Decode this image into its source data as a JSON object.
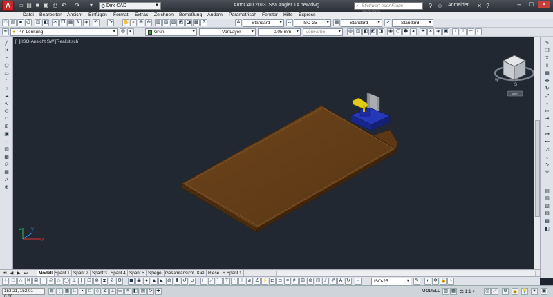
{
  "app": {
    "title": "AutoCAD 2013",
    "document": "Sea Angler 1A new.dwg",
    "workspace": "Dirk CAD",
    "search_placeholder": "Stichwort oder Frage eingeben",
    "signin": "Anmelden",
    "logo_letter": "A"
  },
  "menu": [
    "Datei",
    "Bearbeiten",
    "Ansicht",
    "Einfügen",
    "Format",
    "Extras",
    "Zeichnen",
    "Bemaßung",
    "Ändern",
    "Parametrisch",
    "Fenster",
    "Hilfe",
    "Express"
  ],
  "toolbar1": {
    "text_style": "Standard",
    "dim_style": "ISO-25",
    "table_style": "Standard",
    "mleader_style": "Standard"
  },
  "toolbar2": {
    "layer": "4n-Lenkung",
    "color": "Grün",
    "color_hex": "#2eab3a",
    "linetype": "VonLayer",
    "lineweight": "0.05 mm",
    "plotstyle": "VonFarbe"
  },
  "viewport": {
    "label": "[−][ISO-Ansicht SW][Realistisch]",
    "cube_label": "WKS",
    "compass_w": "W",
    "compass_s": "S"
  },
  "layout_tabs": [
    "Modell",
    "Spant 1",
    "Spant 2",
    "Spant 3",
    "Spant 4",
    "Spant 5",
    "Spiegel",
    "Gesamtansicht",
    "Kiel",
    "Riese",
    "B Spant 1"
  ],
  "active_tab": "Modell",
  "bottom_toolbar": {
    "dim_style": "ISO-25"
  },
  "status": {
    "coords": "153.21, 152.01 , 0.00",
    "space": "MODELL",
    "scale": "1:1"
  },
  "colors": {
    "board": "#5a3615",
    "board_top": "#6b4119",
    "clamp_blue": "#1c2fa5",
    "clamp_yellow": "#e3cc16",
    "viewport_bg": "#212831"
  }
}
